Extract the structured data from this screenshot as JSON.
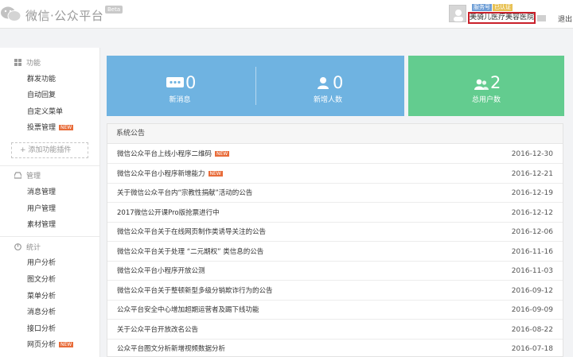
{
  "header": {
    "brand": "微信·公众平台",
    "beta": "Beta",
    "badge_service": "服务号",
    "badge_verified": "已认证",
    "account_name": "美骑儿医疗美容医院",
    "logout": "退出"
  },
  "sidebar": {
    "sections": [
      {
        "title": "功能",
        "items": [
          {
            "label": "群发功能",
            "new": ""
          },
          {
            "label": "自动回复",
            "new": ""
          },
          {
            "label": "自定义菜单",
            "new": ""
          },
          {
            "label": "投票管理",
            "new": "NEW"
          }
        ]
      },
      {
        "title": "管理",
        "items": [
          {
            "label": "消息管理",
            "new": ""
          },
          {
            "label": "用户管理",
            "new": ""
          },
          {
            "label": "素材管理",
            "new": ""
          }
        ]
      },
      {
        "title": "统计",
        "items": [
          {
            "label": "用户分析",
            "new": ""
          },
          {
            "label": "图文分析",
            "new": ""
          },
          {
            "label": "菜单分析",
            "new": ""
          },
          {
            "label": "消息分析",
            "new": ""
          },
          {
            "label": "接口分析",
            "new": ""
          },
          {
            "label": "网页分析",
            "new": "NEW"
          }
        ]
      }
    ],
    "add_plugin": "+ 添加功能插件"
  },
  "stats": [
    {
      "value": "0",
      "label": "新消息",
      "icon": "message-icon"
    },
    {
      "value": "0",
      "label": "新增人数",
      "icon": "user-icon"
    },
    {
      "value": "2",
      "label": "总用户数",
      "icon": "users-icon"
    }
  ],
  "announcements": {
    "title": "系统公告",
    "rows": [
      {
        "title": "微信公众平台上线小程序二维码",
        "new": "NEW",
        "date": "2016-12-30"
      },
      {
        "title": "微信公众平台小程序新增能力",
        "new": "NEW",
        "date": "2016-12-21"
      },
      {
        "title": "关于微信公众平台内“宗教性捐献”活动的公告",
        "new": "",
        "date": "2016-12-19"
      },
      {
        "title": "2017微信公开课Pro版抢票进行中",
        "new": "",
        "date": "2016-12-12"
      },
      {
        "title": "微信公众平台关于在线网页制作类诱导关注的公告",
        "new": "",
        "date": "2016-12-06"
      },
      {
        "title": "微信公众平台关于处理 “二元期权” 类信息的公告",
        "new": "",
        "date": "2016-11-16"
      },
      {
        "title": "微信公众平台小程序开放公测",
        "new": "",
        "date": "2016-11-03"
      },
      {
        "title": "微信公众平台关于整顿新型多级分销欺诈行为的公告",
        "new": "",
        "date": "2016-09-12"
      },
      {
        "title": "公众平台安全中心增加超期运营者及踢下线功能",
        "new": "",
        "date": "2016-09-09"
      },
      {
        "title": "关于公众平台开放改名公告",
        "new": "",
        "date": "2016-08-22"
      },
      {
        "title": "公众平台图文分析新增视频数据分析",
        "new": "",
        "date": "2016-07-18"
      }
    ]
  },
  "colors": {
    "blue_card": "#6fb3e1",
    "green_card": "#63cc8f",
    "highlight_border": "#c9202a",
    "new_badge": "#e86c3a"
  }
}
